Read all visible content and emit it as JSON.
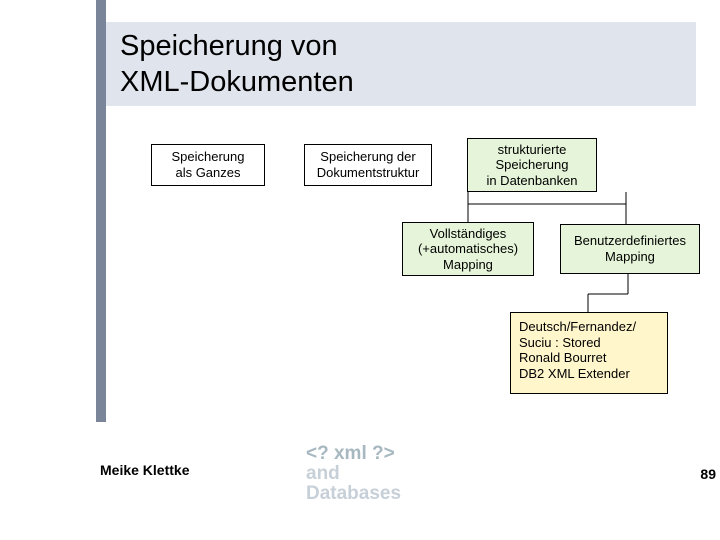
{
  "title_line1": "Speicherung von",
  "title_line2": "XML-Dokumenten",
  "nodes": {
    "n0": "Speicherung\nals Ganzes",
    "n1": "Speicherung der\nDokumentstruktur",
    "n2": "strukturierte\nSpeicherung\nin Datenbanken",
    "n3": "Vollständiges\n(+automatisches)\nMapping",
    "n4": "Benutzerdefiniertes\nMapping",
    "n5": "Deutsch/Fernandez/\n  Suciu : Stored\nRonald Bourret\nDB2 XML Extender"
  },
  "footer": {
    "author": "Meike Klettke",
    "logo_l1": "<? xml ?>",
    "logo_l2": "and",
    "logo_l3": "Databases",
    "page": "89"
  }
}
